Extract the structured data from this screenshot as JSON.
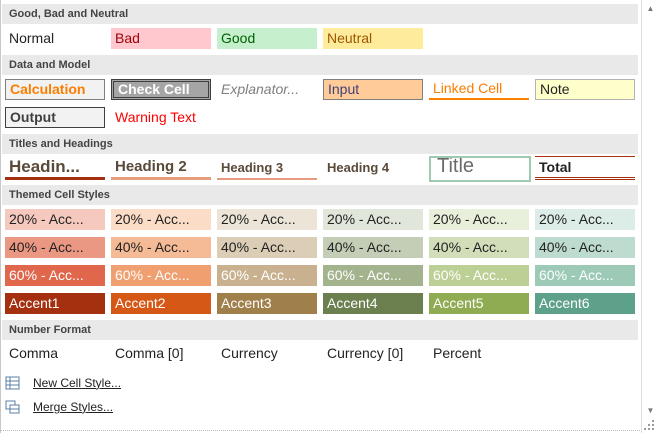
{
  "sections": {
    "good_bad_neutral": "Good, Bad and Neutral",
    "data_model": "Data and Model",
    "titles_headings": "Titles and Headings",
    "themed": "Themed Cell Styles",
    "number_format": "Number Format"
  },
  "good_bad_neutral": {
    "normal": "Normal",
    "bad": "Bad",
    "good": "Good",
    "neutral": "Neutral"
  },
  "data_model": {
    "calculation": "Calculation",
    "check_cell": "Check Cell",
    "explanatory": "Explanator...",
    "input": "Input",
    "linked_cell": "Linked Cell",
    "note": "Note",
    "output": "Output",
    "warning_text": "Warning Text"
  },
  "titles_headings": {
    "heading1": "Headin...",
    "heading2": "Heading 2",
    "heading3": "Heading 3",
    "heading4": "Heading 4",
    "title": "Title",
    "total": "Total"
  },
  "themed": {
    "row20": [
      "20% - Acc...",
      "20% - Acc...",
      "20% - Acc...",
      "20% - Acc...",
      "20% - Acc...",
      "20% - Acc..."
    ],
    "row40": [
      "40% - Acc...",
      "40% - Acc...",
      "40% - Acc...",
      "40% - Acc...",
      "40% - Acc...",
      "40% - Acc..."
    ],
    "row60": [
      "60% - Acc...",
      "60% - Acc...",
      "60% - Acc...",
      "60% - Acc...",
      "60% - Acc...",
      "60% - Acc..."
    ],
    "accent": [
      "Accent1",
      "Accent2",
      "Accent3",
      "Accent4",
      "Accent5",
      "Accent6"
    ]
  },
  "number_format": {
    "comma": "Comma",
    "comma0": "Comma [0]",
    "currency": "Currency",
    "currency0": "Currency [0]",
    "percent": "Percent"
  },
  "menu": {
    "new_cell_style": "New Cell Style...",
    "merge_styles": "Merge Styles..."
  },
  "colors": {
    "bad_bg": "#ffc7ce",
    "bad_fg": "#9c0006",
    "good_bg": "#c6efce",
    "good_fg": "#006100",
    "neutral_bg": "#ffeb9c",
    "neutral_fg": "#9c5700",
    "accent1": "#a5300f",
    "accent2": "#d55816",
    "accent3": "#a0804a",
    "accent4": "#6b7f4f",
    "accent5": "#8fac52",
    "accent6": "#5ea18a"
  }
}
